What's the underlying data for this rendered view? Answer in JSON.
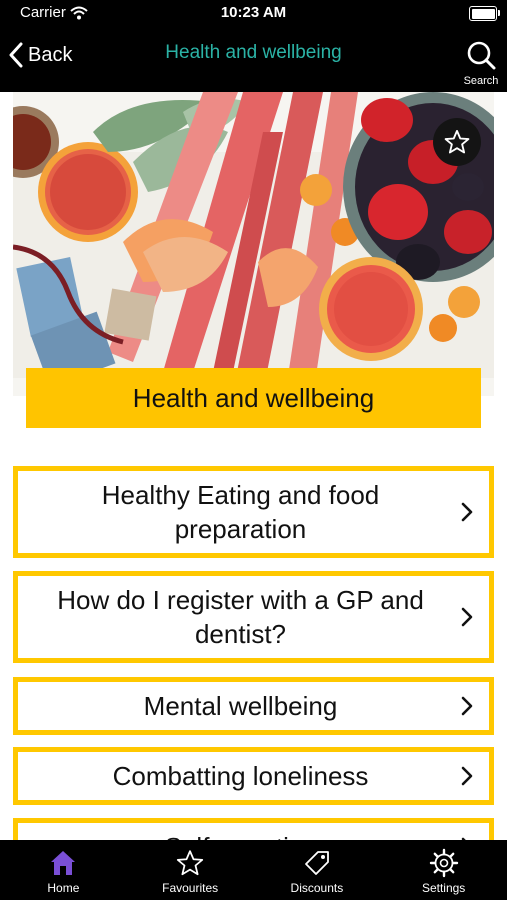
{
  "status_bar": {
    "carrier": "Carrier",
    "time": "10:23 AM"
  },
  "nav": {
    "back_label": "Back",
    "title": "Health and wellbeing",
    "search_label": "Search"
  },
  "section": {
    "title": "Health and wellbeing"
  },
  "items": [
    {
      "label": "Healthy Eating and food preparation"
    },
    {
      "label": "How do I register with a GP and dentist?"
    },
    {
      "label": "Mental wellbeing"
    },
    {
      "label": "Combatting loneliness"
    },
    {
      "label": "Self-care tips"
    }
  ],
  "tabs": [
    {
      "label": "Home",
      "icon": "house-icon",
      "active": true
    },
    {
      "label": "Favourites",
      "icon": "star-icon",
      "active": false
    },
    {
      "label": "Discounts",
      "icon": "tag-icon",
      "active": false
    },
    {
      "label": "Settings",
      "icon": "gear-icon",
      "active": false
    }
  ],
  "colors": {
    "accent_teal": "#2bb3a6",
    "banner_yellow": "#ffc400",
    "border_yellow": "#ffc800",
    "active_tab": "#7a4fd6"
  }
}
